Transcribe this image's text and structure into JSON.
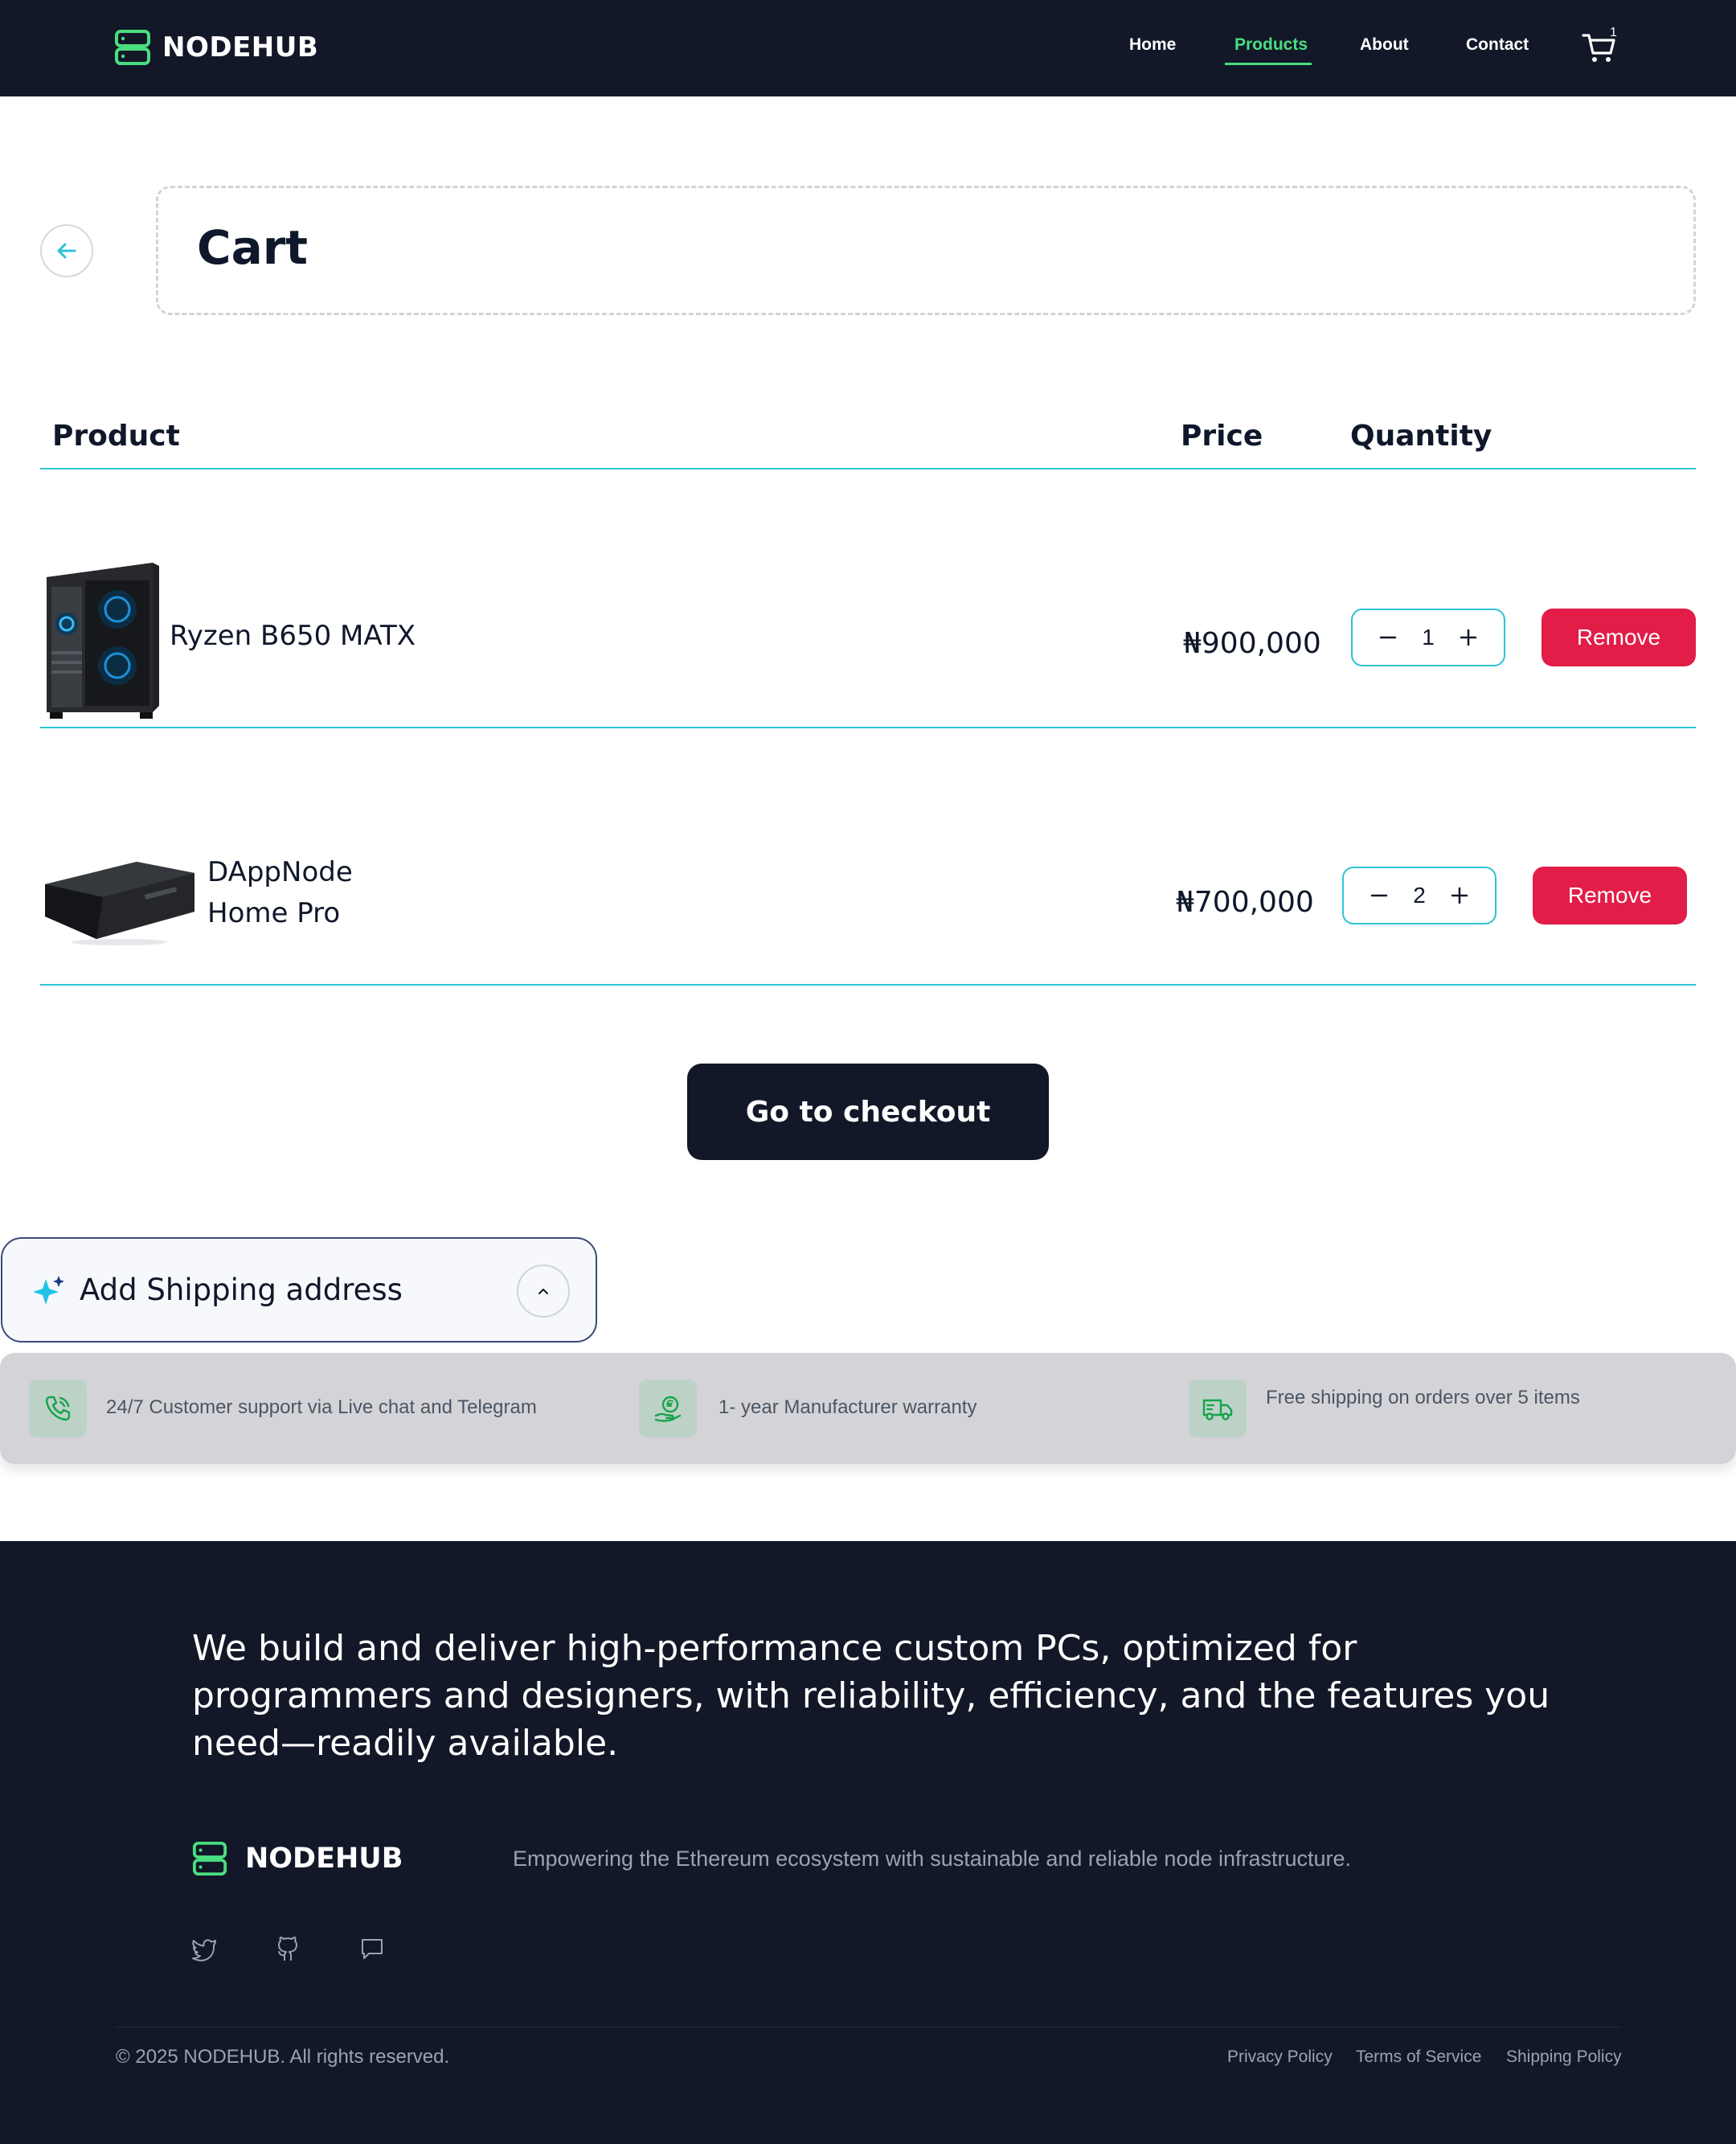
{
  "nav": {
    "brand": "NODEHUB",
    "links": [
      {
        "label": "Home",
        "active": false
      },
      {
        "label": "Products",
        "active": true
      },
      {
        "label": "About",
        "active": false
      },
      {
        "label": "Contact",
        "active": false
      }
    ],
    "cart_count": "1",
    "accent": "#4ade80",
    "background": "#121828"
  },
  "cart": {
    "title": "Cart",
    "headers": {
      "product": "Product",
      "price": "Price",
      "quantity": "Quantity"
    },
    "items": [
      {
        "name": "Ryzen B650 MATX",
        "price": "₦900,000",
        "quantity": "1",
        "remove_label": "Remove",
        "image": "pc-case-icon"
      },
      {
        "name": "DAppNode Home Pro",
        "price": "₦700,000",
        "quantity": "2",
        "remove_label": "Remove",
        "image": "mini-pc-icon"
      }
    ],
    "checkout_label": "Go to checkout",
    "rule_color": "#2ec3d4",
    "remove_color": "#e11d48"
  },
  "shipping": {
    "label": "Add Shipping address",
    "icon": "sparkle-icon"
  },
  "features": [
    {
      "icon": "phone-icon",
      "text": "24/7 Customer support via Live chat and Telegram"
    },
    {
      "icon": "warranty-coin-icon",
      "text": "1- year Manufacturer warranty"
    },
    {
      "icon": "truck-icon",
      "text": "Free shipping on orders over 5 items"
    }
  ],
  "footer": {
    "tagline": "We build and deliver high-performance custom PCs, optimized for programmers and designers, with reliability, efficiency, and the features you need—readily available.",
    "brand": "NODEHUB",
    "mission": "Empowering the Ethereum ecosystem with sustainable and reliable node infrastructure.",
    "social": [
      "twitter-icon",
      "github-icon",
      "chat-icon"
    ],
    "copyright": "© 2025 NODEHUB. All rights reserved.",
    "links": [
      "Privacy Policy",
      "Terms of Service",
      "Shipping Policy"
    ]
  }
}
